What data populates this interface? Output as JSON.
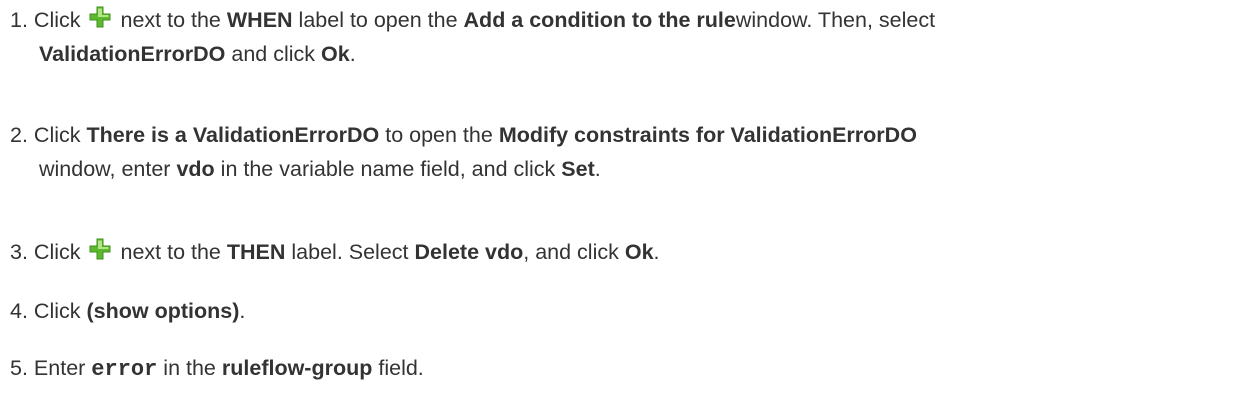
{
  "steps": [
    {
      "number": "1.",
      "t1": "Click",
      "t2": "next to the",
      "b1": "WHEN",
      "t3": "label to open the",
      "b2": "Add a condition to the rule",
      "t4": "window. Then, select",
      "b3": "ValidationErrorDO",
      "t5": "and click",
      "b4": "Ok",
      "t6": ".",
      "icon": "green-plus-icon"
    },
    {
      "number": "2.",
      "t1": "Click",
      "b1": "There is a ValidationErrorDO",
      "t2": "to open the",
      "b2": "Modify constraints for ValidationErrorDO",
      "t3": "window, enter",
      "b3": "vdo",
      "t4": "in the variable name field, and click",
      "b4": "Set",
      "t5": "."
    },
    {
      "number": "3.",
      "t1": "Click",
      "t2": "next to the",
      "b1": "THEN",
      "t3": "label. Select",
      "b2": "Delete vdo",
      "t4": ", and click",
      "b3": "Ok",
      "t5": ".",
      "icon": "green-plus-icon"
    },
    {
      "number": "4.",
      "t1": "Click",
      "b1": "(show options)",
      "t2": "."
    },
    {
      "number": "5.",
      "t1": "Enter",
      "code1": "error",
      "t2": "in the",
      "b1": "ruleflow-group",
      "t3": "field."
    }
  ],
  "colors": {
    "text": "#333333",
    "icon_green": "#5cb82e",
    "icon_highlight": "#c8f09a"
  }
}
